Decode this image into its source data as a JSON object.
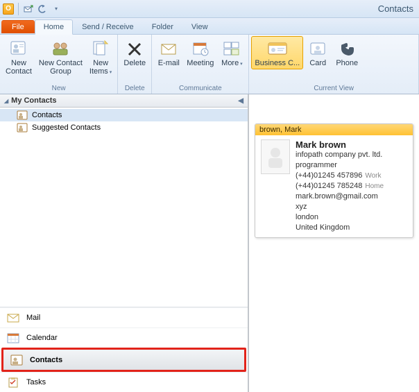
{
  "app_title": "Contacts",
  "tabs": {
    "file": "File",
    "home": "Home",
    "sendreceive": "Send / Receive",
    "folder": "Folder",
    "view": "View"
  },
  "ribbon": {
    "new": {
      "label": "New",
      "contact": "New\nContact",
      "group": "New Contact\nGroup",
      "items": "New\nItems"
    },
    "delete": {
      "label": "Delete",
      "delete": "Delete"
    },
    "communicate": {
      "label": "Communicate",
      "email": "E-mail",
      "meeting": "Meeting",
      "more": "More"
    },
    "view": {
      "label": "Current View",
      "business": "Business C...",
      "card": "Card",
      "phone": "Phone"
    }
  },
  "sidebar": {
    "header": "My Contacts",
    "items": [
      {
        "label": "Contacts"
      },
      {
        "label": "Suggested Contacts"
      }
    ],
    "nav": {
      "mail": "Mail",
      "calendar": "Calendar",
      "contacts": "Contacts",
      "tasks": "Tasks"
    }
  },
  "card": {
    "header": "brown, Mark",
    "name": "Mark brown",
    "company": "infopath company pvt. ltd.",
    "title": "programmer",
    "phone_work": "(+44)01245 457896",
    "phone_work_type": "Work",
    "phone_home": "(+44)01245 785248",
    "phone_home_type": "Home",
    "email": "mark.brown@gmail.com",
    "addr1": "xyz",
    "addr2": "london",
    "addr3": "United Kingdom"
  }
}
